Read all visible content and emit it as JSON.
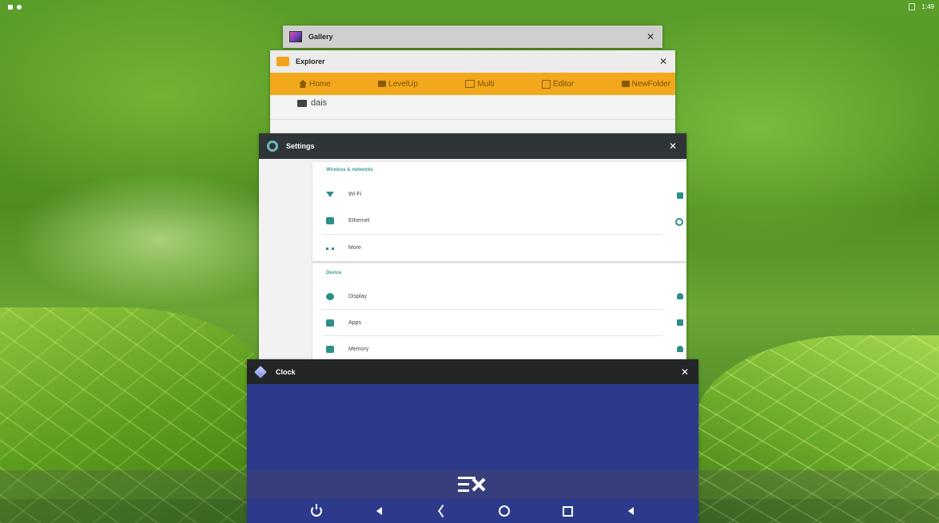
{
  "status_bar": {
    "time": "1:49"
  },
  "windows": {
    "gallery": {
      "title": "Gallery",
      "close": "✕",
      "icon": "gallery-app-icon"
    },
    "explorer": {
      "title": "Explorer",
      "close": "✕",
      "icon": "explorer-app-icon",
      "toolbar": [
        {
          "label": "Home",
          "icon": "home-icon"
        },
        {
          "label": "LevelUp",
          "icon": "folder-up-icon"
        },
        {
          "label": "Multi",
          "icon": "multi-select-icon"
        },
        {
          "label": "Editor",
          "icon": "edit-icon"
        },
        {
          "label": "NewFolder",
          "icon": "new-folder-icon"
        }
      ],
      "items": [
        {
          "name": "dais",
          "icon": "folder-icon"
        }
      ]
    },
    "settings": {
      "title": "Settings",
      "close": "✕",
      "icon": "settings-gear-icon",
      "section1": {
        "header": "Wireless & networks",
        "rows": [
          {
            "label": "Wi-Fi",
            "icon": "wifi-icon"
          },
          {
            "label": "Ethernet",
            "icon": "ethernet-icon"
          },
          {
            "label": "More",
            "icon": "more-dots-icon"
          }
        ]
      },
      "section2": {
        "header": "Device",
        "rows": [
          {
            "label": "Display",
            "icon": "display-icon"
          },
          {
            "label": "Apps",
            "icon": "apps-icon"
          },
          {
            "label": "Memory",
            "icon": "memory-icon"
          }
        ]
      }
    },
    "clock": {
      "title": "Clock",
      "close": "✕",
      "icon": "clock-app-icon"
    }
  },
  "recents": {
    "clear_all": "clear-all-icon"
  },
  "nav_bar": [
    "power-icon",
    "volume-down-icon",
    "back-icon",
    "home-icon",
    "recent-apps-icon",
    "volume-up-icon"
  ],
  "colors": {
    "explorer_toolbar": "#f2a81c",
    "settings_titlebar": "#2f3537",
    "settings_accent": "#2b8f8a",
    "clock_background": "#2d3a8c",
    "clock_titlebar": "#232526"
  }
}
